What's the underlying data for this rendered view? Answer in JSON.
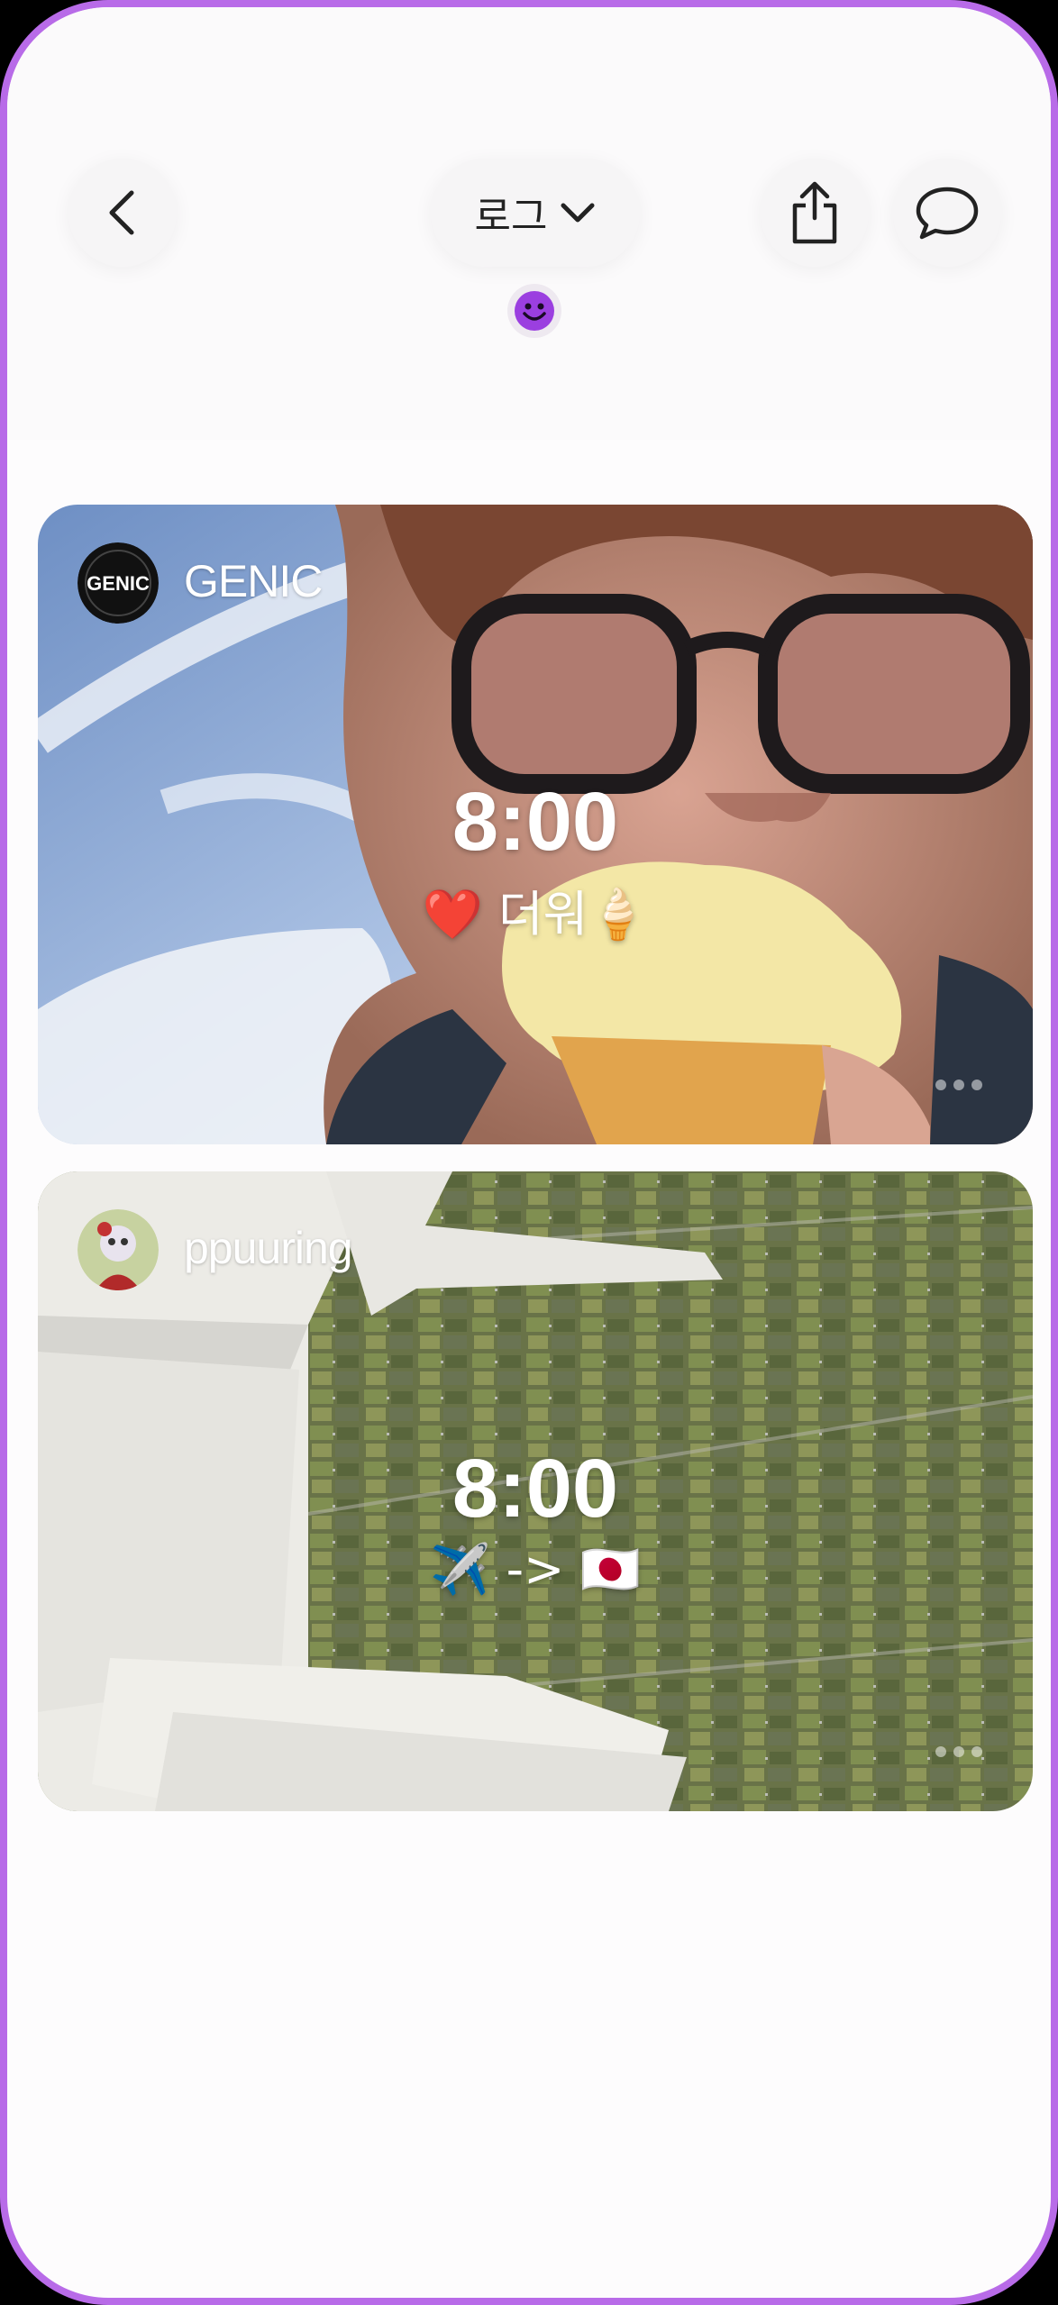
{
  "header": {
    "back_icon": "chevron-left-icon",
    "title": "로그",
    "title_dropdown_icon": "chevron-down-icon",
    "share_icon": "share-icon",
    "comment_icon": "chat-bubble-icon",
    "status_emoji_icon": "smiley-face-icon"
  },
  "colors": {
    "accent": "#b86be8",
    "emoji": "#9b3fe0"
  },
  "posts": [
    {
      "username": "GENIC",
      "avatar_text": "GENIC",
      "time": "8:00",
      "caption": "❤️ 더워🍦"
    },
    {
      "username": "ppuuring",
      "time": "8:00",
      "caption": "✈️ -> 🇯🇵"
    }
  ]
}
